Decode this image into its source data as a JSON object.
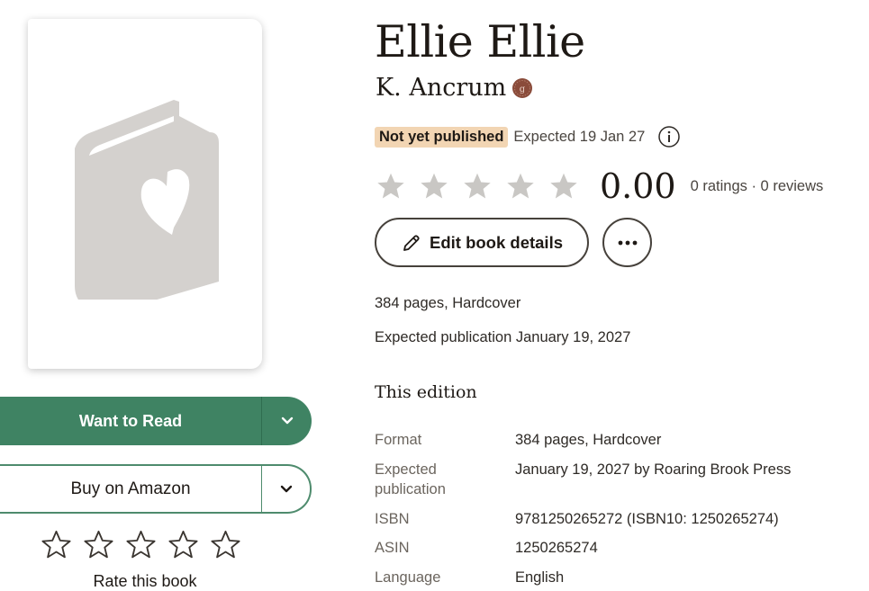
{
  "book": {
    "title": "Ellie Ellie",
    "author": "K. Ancrum",
    "status_pill": "Not yet published",
    "expected_short": "Expected 19 Jan 27",
    "average_rating": "0.00",
    "counts": "0 ratings · 0 reviews",
    "pages_format": "384 pages, Hardcover",
    "expected_publication": "Expected publication January 19, 2027"
  },
  "actions": {
    "edit_label": "Edit book details",
    "want_to_read": "Want to Read",
    "buy_amazon": "Buy on Amazon",
    "rate_label": "Rate this book"
  },
  "edition": {
    "heading": "This edition",
    "rows": [
      {
        "label": "Format",
        "value": "384 pages, Hardcover"
      },
      {
        "label": "Expected publication",
        "value": "January 19, 2027 by Roaring Brook Press"
      },
      {
        "label": "ISBN",
        "value": "9781250265272 (ISBN10: 1250265274)"
      },
      {
        "label": "ASIN",
        "value": "1250265274"
      },
      {
        "label": "Language",
        "value": "English"
      }
    ]
  },
  "colors": {
    "primary_green": "#3f8363",
    "pill_bg": "#f2d5b3",
    "star_gray": "#c9c7c4",
    "goodreads_badge": "#8a4b3a"
  },
  "icons": [
    "book-heart-icon",
    "chevron-down-icon",
    "star-outline-icon",
    "goodreads-author-icon",
    "info-icon",
    "star-filled-icon",
    "pencil-icon",
    "more-icon"
  ]
}
